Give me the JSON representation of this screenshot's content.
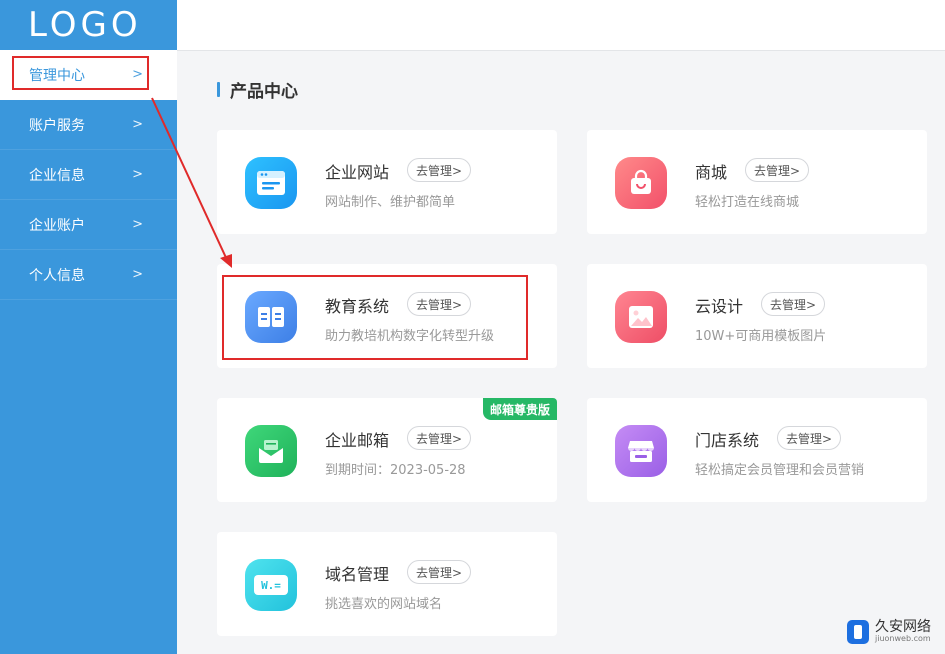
{
  "logo": "LOGO",
  "sidebar": {
    "items": [
      {
        "label": "管理中心",
        "active": true
      },
      {
        "label": "账户服务",
        "active": false
      },
      {
        "label": "企业信息",
        "active": false
      },
      {
        "label": "企业账户",
        "active": false
      },
      {
        "label": "个人信息",
        "active": false
      }
    ],
    "chevron": ">"
  },
  "section": {
    "title": "产品中心"
  },
  "cards": [
    {
      "name": "企业网站",
      "manage": "去管理>",
      "desc": "网站制作、维护都简单",
      "icon": "browser-window-icon"
    },
    {
      "name": "商城",
      "manage": "去管理>",
      "desc": "轻松打造在线商城",
      "icon": "shopping-bag-icon"
    },
    {
      "name": "教育系统",
      "manage": "去管理>",
      "desc": "助力教培机构数字化转型升级",
      "icon": "open-book-icon"
    },
    {
      "name": "云设计",
      "manage": "去管理>",
      "desc": "10W+可商用模板图片",
      "icon": "image-icon"
    },
    {
      "name": "企业邮箱",
      "manage": "去管理>",
      "desc": "到期时间：2023-05-28",
      "icon": "mail-envelope-icon",
      "badge": "邮箱尊贵版"
    },
    {
      "name": "门店系统",
      "manage": "去管理>",
      "desc": "轻松搞定会员管理和会员营销",
      "icon": "storefront-icon"
    },
    {
      "name": "域名管理",
      "manage": "去管理>",
      "desc": "挑选喜欢的网站域名",
      "icon": "domain-www-icon",
      "icon_text": "W.="
    }
  ],
  "colors": {
    "sidebar": "#3a97dc",
    "annotation": "#e02a2a",
    "badge": "#26b866"
  },
  "watermark": {
    "main": "久安网络",
    "sub": "jiuonweb.com"
  }
}
